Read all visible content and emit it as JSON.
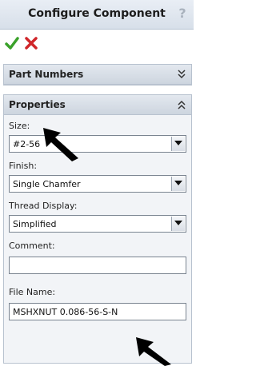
{
  "header": {
    "title": "Configure Component",
    "help_glyph": "?"
  },
  "actions": {
    "ok_icon": "checkmark-icon",
    "cancel_icon": "x-icon"
  },
  "sections": {
    "part_numbers": {
      "title": "Part Numbers",
      "state": "collapsed"
    },
    "properties": {
      "title": "Properties",
      "state": "expanded"
    }
  },
  "fields": {
    "size": {
      "label": "Size:",
      "value": "#2-56"
    },
    "finish": {
      "label": "Finish:",
      "value": "Single Chamfer"
    },
    "thread_display": {
      "label": "Thread Display:",
      "value": "Simplified"
    },
    "comment": {
      "label": "Comment:",
      "value": ""
    },
    "file_name": {
      "label": "File Name:",
      "value": "MSHXNUT 0.086-56-S-N"
    }
  },
  "colors": {
    "ok": "#3aa12a",
    "cancel": "#d0262a"
  }
}
